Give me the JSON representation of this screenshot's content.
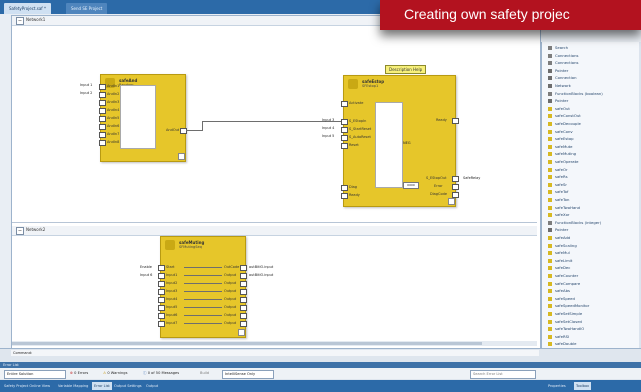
{
  "banner": {
    "text": "Creating own safety projec"
  },
  "tabs": {
    "doc1": "SafetyProject.saf *",
    "doc2": "Send SE Project"
  },
  "networks": {
    "n1": "Network1",
    "n2": "Network2"
  },
  "fb1": {
    "title": "safeAnd",
    "subtitle": "Random",
    "inputs": [
      "AndIn1",
      "AndIn2",
      "AndIn3",
      "AndIn4",
      "AndIn5",
      "AndIn6",
      "AndIn7",
      "AndIn8"
    ],
    "output": "AndOut",
    "ext_inputs": [
      "Input 1",
      "Input 2"
    ]
  },
  "fb2": {
    "title": "safeEstop",
    "subtitle": "SFEstop1",
    "tooltip": "Description Help",
    "inputs": [
      "Activate",
      "S_EStopIn",
      "S_StartReset",
      "S_AutoReset",
      "Reset"
    ],
    "inputs_lower": [
      "Diag",
      "Ready"
    ],
    "outputs": [
      "Ready",
      "S_EStopOut",
      "Error",
      "DiagCode"
    ],
    "status": "0000",
    "ext_inputs": [
      "Input 3",
      "Input 4",
      "Input 5"
    ],
    "ext_output": "SafeRelay",
    "neg_label": "NEG"
  },
  "fb3": {
    "title": "safeMuting",
    "subtitle": "SFMutingSeq",
    "inputs": [
      "Start",
      "Input1",
      "Input2",
      "Input3",
      "Input4",
      "Input5",
      "Input6",
      "Input7"
    ],
    "outputs": [
      "OutCode",
      "Output",
      "Output",
      "Output",
      "Output",
      "Output",
      "Output",
      "Output"
    ],
    "ext_inputs": [
      "Enable",
      "Input 6"
    ],
    "ext_outputs": [
      "outBitIO.input",
      "outBitIO.input"
    ]
  },
  "right_panel": {
    "items": [
      {
        "label": "Search",
        "icon_color": "#7d7d7d"
      },
      {
        "label": "Connections",
        "icon_color": "#7d7d7d"
      },
      {
        "label": "Connections",
        "icon_color": "#7d7d7d"
      },
      {
        "label": "Pointer",
        "icon_color": "#6d6d6d"
      },
      {
        "label": "Connection",
        "icon_color": "#6d6d6d"
      },
      {
        "label": "Network",
        "icon_color": "#6d6d6d"
      },
      {
        "label": "FunctionBlocks (boolean)",
        "icon_color": "#7d7d7d"
      },
      {
        "label": "Pointer",
        "icon_color": "#6d6d6d"
      },
      {
        "label": "safeOut",
        "icon_color": "#d7b922"
      },
      {
        "label": "safeConstOut",
        "icon_color": "#d7b922"
      },
      {
        "label": "safeDecouple",
        "icon_color": "#d7b922"
      },
      {
        "label": "safeConv",
        "icon_color": "#d7b922"
      },
      {
        "label": "safeEstop",
        "icon_color": "#d7b922"
      },
      {
        "label": "safeMute",
        "icon_color": "#d7b922"
      },
      {
        "label": "safeMuting",
        "icon_color": "#d7b922"
      },
      {
        "label": "safeOperate",
        "icon_color": "#d7b922"
      },
      {
        "label": "safeOr",
        "icon_color": "#d7b922"
      },
      {
        "label": "safeRs",
        "icon_color": "#d7b922"
      },
      {
        "label": "safeSr",
        "icon_color": "#d7b922"
      },
      {
        "label": "safeTof",
        "icon_color": "#d7b922"
      },
      {
        "label": "safeTon",
        "icon_color": "#d7b922"
      },
      {
        "label": "safeTwoHand",
        "icon_color": "#d7b922"
      },
      {
        "label": "safeXor",
        "icon_color": "#d7b922"
      },
      {
        "label": "FunctionBlocks (integer)",
        "icon_color": "#7d7d7d"
      },
      {
        "label": "Pointer",
        "icon_color": "#6d6d6d"
      },
      {
        "label": "safeAdd",
        "icon_color": "#d7b922"
      },
      {
        "label": "safeScaling",
        "icon_color": "#d7b922"
      },
      {
        "label": "safeMul",
        "icon_color": "#d7b922"
      },
      {
        "label": "safeLimit",
        "icon_color": "#d7b922"
      },
      {
        "label": "safeDec",
        "icon_color": "#d7b922"
      },
      {
        "label": "safeCounter",
        "icon_color": "#d7b922"
      },
      {
        "label": "safeCompare",
        "icon_color": "#d7b922"
      },
      {
        "label": "safeAbs",
        "icon_color": "#d7b922"
      },
      {
        "label": "safeSpeed",
        "icon_color": "#d7b922"
      },
      {
        "label": "safeSpeedMonitor",
        "icon_color": "#d7b922"
      },
      {
        "label": "safeSetSimple",
        "icon_color": "#d7b922"
      },
      {
        "label": "safeSetClosed",
        "icon_color": "#d7b922"
      },
      {
        "label": "safeTwoHandIO",
        "icon_color": "#d7b922"
      },
      {
        "label": "safeRSI",
        "icon_color": "#d7b922"
      },
      {
        "label": "safeDouble",
        "icon_color": "#d7b922"
      },
      {
        "label": "safeAnalogIn",
        "icon_color": "#d7b922"
      },
      {
        "label": "General",
        "icon_color": "#7d7d7d"
      }
    ]
  },
  "command_label": "Command:",
  "error_list": {
    "header": "Error List",
    "scope": "Entire Solution",
    "errors": "0 Errors",
    "warnings": "0 Warnings",
    "messages": "0 of 50 Messages",
    "build": "Build",
    "filter": "IntelliSense Only",
    "search_placeholder": "Search Error List"
  },
  "bottom_tabs": [
    "Safety Project Online View",
    "Variable Mapping",
    "Error List",
    "Output Settings",
    "Output"
  ],
  "right_bottom_tabs": [
    "Properties",
    "Toolbox"
  ]
}
